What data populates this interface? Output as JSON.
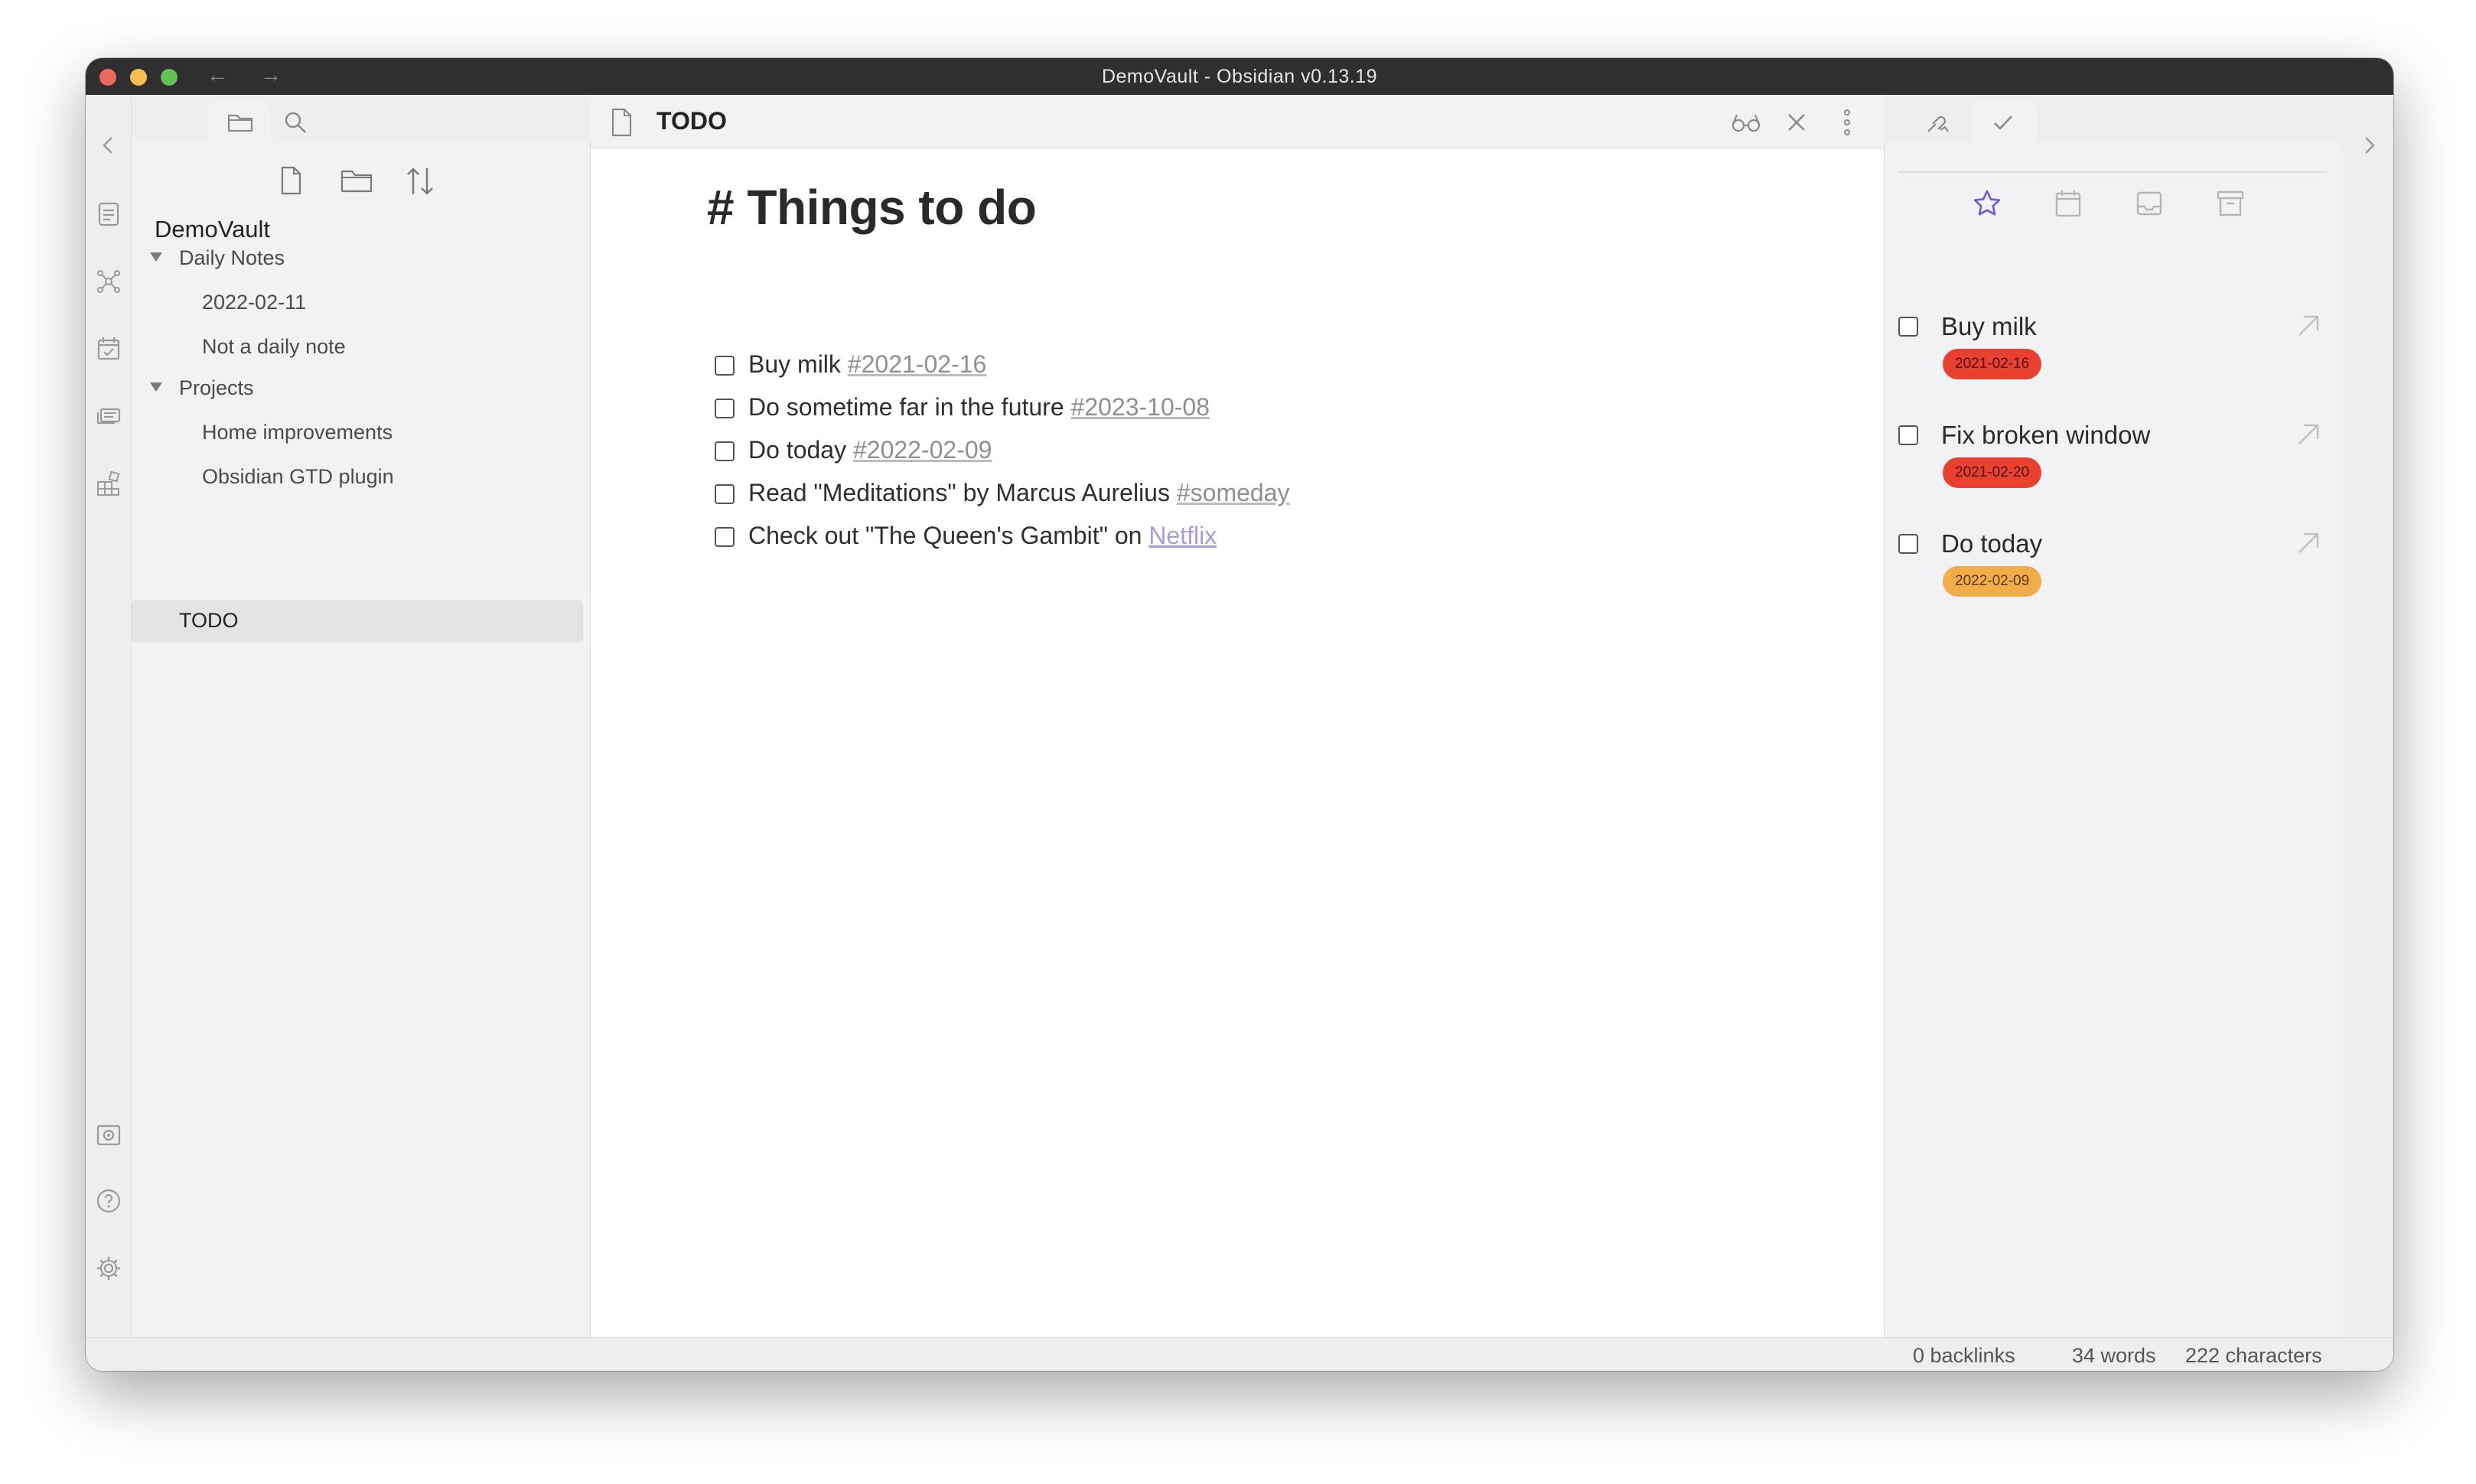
{
  "window": {
    "title": "DemoVault - Obsidian v0.13.19"
  },
  "file_explorer": {
    "vault_name": "DemoVault",
    "items": [
      {
        "label": "Daily Notes",
        "type": "folder",
        "expanded": true
      },
      {
        "label": "2022-02-11",
        "type": "file"
      },
      {
        "label": "Not a daily note",
        "type": "file"
      },
      {
        "label": "Projects",
        "type": "folder",
        "expanded": true
      },
      {
        "label": "Home improvements",
        "type": "file"
      },
      {
        "label": "Obsidian GTD plugin",
        "type": "file"
      },
      {
        "label": "TODO",
        "type": "file",
        "selected": true
      }
    ]
  },
  "editor": {
    "tab_title": "TODO",
    "heading": "# Things to do",
    "tasks": [
      {
        "text": "Buy milk ",
        "tag": "#2021-02-16"
      },
      {
        "text": "Do sometime far in the future ",
        "tag": "#2023-10-08"
      },
      {
        "text": "Do today ",
        "tag": "#2022-02-09"
      },
      {
        "text": "Read \"Meditations\" by Marcus Aurelius ",
        "tag": "#someday"
      },
      {
        "text": "Check out \"The Queen's Gambit\" on ",
        "link": "Netflix"
      }
    ]
  },
  "gtd_panel": {
    "tasks": [
      {
        "label": "Buy milk",
        "date": "2021-02-16",
        "badge_color": "#e8412f"
      },
      {
        "label": "Fix broken window",
        "date": "2021-02-20",
        "badge_color": "#e8412f"
      },
      {
        "label": "Do today",
        "date": "2022-02-09",
        "badge_color": "#f2ad4a"
      }
    ],
    "accent_color": "#6a5bd6"
  },
  "status_bar": {
    "backlinks": "0 backlinks",
    "words": "34 words",
    "characters": "222 characters"
  }
}
